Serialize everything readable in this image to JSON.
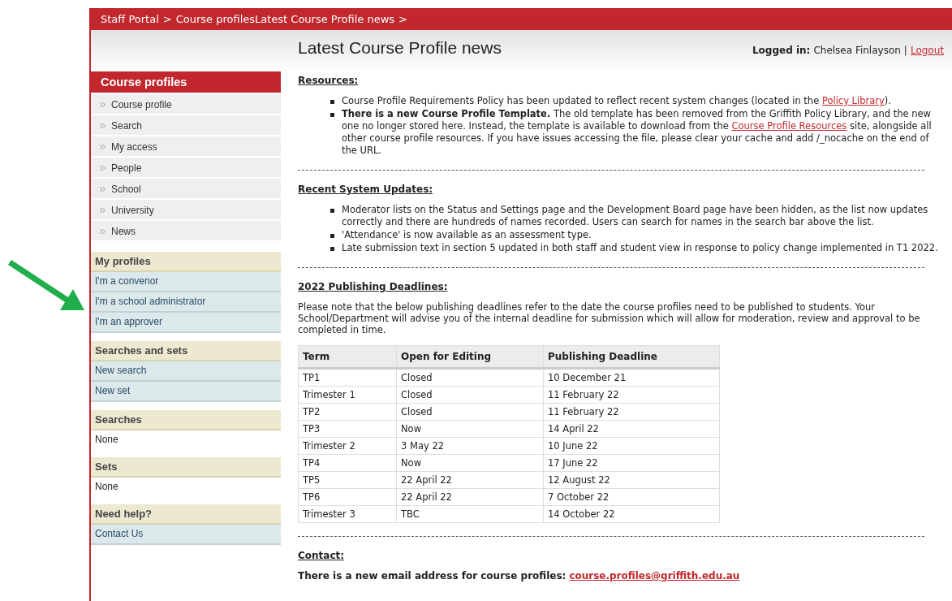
{
  "breadcrumb": [
    "Staff Portal",
    ">",
    "Course profilesLatest Course Profile news",
    ">"
  ],
  "sidebar": {
    "title": "Course profiles",
    "nav": [
      {
        "label": "Course profile"
      },
      {
        "label": "Search"
      },
      {
        "label": "My access"
      },
      {
        "label": "People"
      },
      {
        "label": "School"
      },
      {
        "label": "University"
      },
      {
        "label": "News"
      }
    ],
    "sections": [
      {
        "title": "My profiles",
        "kind": "links",
        "items": [
          "I'm a convenor",
          "I'm a school administrator",
          "I'm an approver"
        ]
      },
      {
        "title": "Searches and sets",
        "kind": "links",
        "items": [
          "New search",
          "New set"
        ]
      },
      {
        "title": "Searches",
        "kind": "text",
        "items": [
          "None"
        ]
      },
      {
        "title": "Sets",
        "kind": "text",
        "items": [
          "None"
        ]
      },
      {
        "title": "Need help?",
        "kind": "links",
        "items": [
          "Contact Us"
        ]
      }
    ]
  },
  "page": {
    "title": "Latest Course Profile news",
    "login_label": "Logged in:",
    "user": "Chelsea Finlayson",
    "separator": "|",
    "logout": "Logout"
  },
  "sections": [
    {
      "heading": "Resources:",
      "kind": "bullets",
      "items": [
        [
          {
            "text": "Course Profile Requirements Policy has been updated to reflect recent system changes (located in the "
          },
          {
            "link": "Policy Library"
          },
          {
            "text": ")."
          }
        ],
        [
          {
            "text": "**There is a new Course Profile Template.** The old template has been removed from the Griffith Policy Library, and the new one no longer stored here. Instead, the template is available to download from the "
          },
          {
            "link": "Course Profile Resources"
          },
          {
            "text": " site, alongside all other course profile resources. If you have issues accessing the file, please clear your cache and add /_nocache on the end of the URL."
          }
        ]
      ]
    },
    {
      "heading": "Recent System Updates:",
      "kind": "bullets",
      "items": [
        [
          {
            "text": "Moderator lists on the Status and Settings page and the Development Board page have been hidden, as the list now updates correctly and there are hundreds of names recorded. Users can search for names in the search bar above the list."
          }
        ],
        [
          {
            "text": "'Attendance' is now available as an assessment type."
          }
        ],
        [
          {
            "text": "Late submission text in section 5 updated in both staff and student view in response to policy change implemented in T1 2022."
          }
        ]
      ]
    },
    {
      "heading": "2022 Publishing Deadlines:",
      "kind": "table",
      "intro": "Please note that the below publishing deadlines refer to the date the course profiles need to be published to students. Your School/Department will advise you of the internal deadline for submission which will allow for moderation, review and approval to be completed in time.",
      "columns": [
        "Term",
        "Open for Editing",
        "Publishing Deadline"
      ],
      "rows": [
        [
          "TP1",
          "Closed",
          "10 December 21"
        ],
        [
          "Trimester 1",
          "Closed",
          "11 February 22"
        ],
        [
          "TP2",
          "Closed",
          "11 February 22"
        ],
        [
          "TP3",
          "Now",
          "14 April 22"
        ],
        [
          "Trimester 2",
          "3 May 22",
          "10 June 22"
        ],
        [
          "TP4",
          "Now",
          "17 June 22"
        ],
        [
          "TP5",
          "22 April 22",
          "12 August 22"
        ],
        [
          "TP6",
          "22 April 22",
          "7 October 22"
        ],
        [
          "Trimester 3",
          "TBC",
          "14 October 22"
        ]
      ]
    },
    {
      "heading": "Contact:",
      "kind": "contact",
      "text": "There is a new email address for course profiles:",
      "link": "course.profiles@griffith.edu.au"
    }
  ]
}
